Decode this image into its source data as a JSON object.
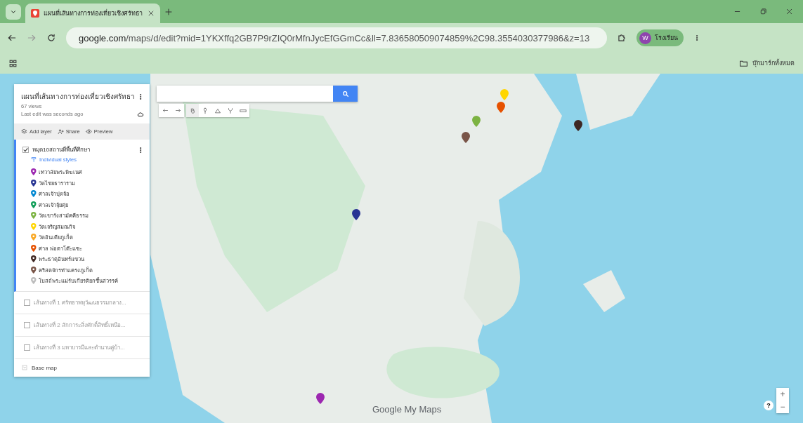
{
  "browser": {
    "tabs": [
      {
        "title": "แผนที่เส้นทางการท่องเที่ยวเชิงศรัทธา",
        "selected": true
      }
    ],
    "url_host": "google.com",
    "url_path": "/maps/d/edit?mid=1YKXffq2GB7P9rZIQ0rMfnJycEfGGmCc&ll=7.836580509074859%2C98.3554030377986&z=13",
    "profile": {
      "initial": "W",
      "name": "โรงเรียน"
    },
    "bookmarks_folder": "บุ๊กมาร์กทั้งหมด"
  },
  "panel": {
    "title": "แผนที่เส้นทางการท่องเที่ยวเชิงศรัทธา",
    "views": "67 views",
    "last_edit": "Last edit was seconds ago",
    "actions": [
      "Add layer",
      "Share",
      "Preview"
    ],
    "layers": [
      {
        "title": "หมุด10สถานที่พื้นที่ศึกษา",
        "checked": true,
        "selected": true,
        "style": "Individual styles",
        "items": [
          {
            "label": "เทวาลัยพระพิฆเนศ",
            "color": "#9c27b0"
          },
          {
            "label": "วัดไชยธาราราม",
            "color": "#283593"
          },
          {
            "label": "ศาลเจ้าปุดจ้อ",
            "color": "#0288d1"
          },
          {
            "label": "ศาลเจ้าจุ้ยตุ่ย",
            "color": "#0f9d58"
          },
          {
            "label": "วัดเขารังสามัคคีธรรม",
            "color": "#7cb342"
          },
          {
            "label": "วัดเจริญสมณกิจ",
            "color": "#ffd600"
          },
          {
            "label": "วัดอินเดียภูเก็ต",
            "color": "#f9a825"
          },
          {
            "label": "ศาล พ่อตาโต๊ะแซะ",
            "color": "#e65100"
          },
          {
            "label": "พระธาตุอินทร์แขวน",
            "color": "#3e2723"
          },
          {
            "label": "คริสตจักรท่าแครงภูเก็ต",
            "color": "#795548"
          },
          {
            "label": "โบสถ์พระแม่รับเกียรติยกขึ้นสวรรค์",
            "color": "#bdbdbd"
          }
        ]
      },
      {
        "title": "เส้นทางที่ 1 ศรัทธาพหุวัฒนธรรมกลาง...",
        "checked": false,
        "selected": false
      },
      {
        "title": "เส้นทางที่ 2 สักการะสิ่งศักดิ์สิทธิ์เหนือ...",
        "checked": false,
        "selected": false
      },
      {
        "title": "เส้นทางที่ 3 มหาบารมีและตำนานคู่บ้า...",
        "checked": false,
        "selected": false
      }
    ],
    "base_map": "Base map"
  },
  "map": {
    "logo": "Google My Maps",
    "help": "?",
    "zoom_in": "+",
    "zoom_out": "−"
  }
}
